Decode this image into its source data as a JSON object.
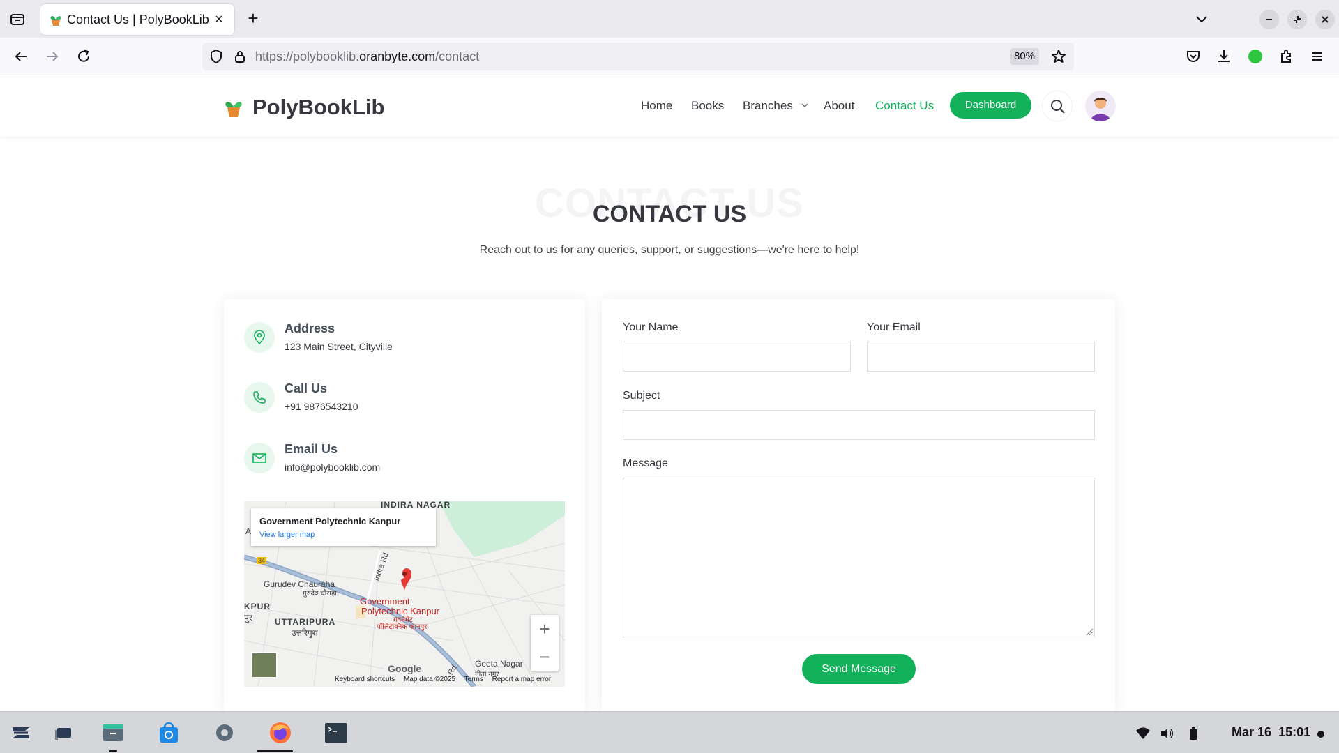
{
  "browser": {
    "tab_title": "Contact Us | PolyBookLib",
    "url_prefix": "https://polybooklib.",
    "url_domain": "oranbyte.com",
    "url_path": "/contact",
    "zoom": "80%"
  },
  "site": {
    "brand": "PolyBookLib",
    "nav": {
      "home": "Home",
      "books": "Books",
      "branches": "Branches",
      "about": "About",
      "contact": "Contact Us",
      "dashboard": "Dashboard"
    },
    "accent_color": "#13b15a"
  },
  "section": {
    "title_bg": "CONTACT US",
    "title": "CONTACT US",
    "subtitle": "Reach out to us for any queries, support, or suggestions—we're here to help!"
  },
  "contact_info": {
    "address_title": "Address",
    "address_value": "123 Main Street, Cityville",
    "phone_title": "Call Us",
    "phone_value": "+91 9876543210",
    "email_title": "Email Us",
    "email_value": "info@polybooklib.com"
  },
  "map": {
    "place_title": "Government Polytechnic Kanpur",
    "larger_map_link": "View larger map",
    "labels": {
      "indira_nagar": "INDIRA NAGAR",
      "gurudev": "Gurudev Chauraha",
      "gurudev_hi": "गुरुदेव चौराहा",
      "indra_rd": "Indra Rd",
      "kpur": "KPUR",
      "kpur_hi": "पुर",
      "uttaripura": "UTTARIPURA",
      "uttaripura_hi": "उत्तरिपुरा",
      "gov_poly_1": "Government",
      "gov_poly_2": "Polytechnic Kanpur",
      "gov_poly_hi1": "गवर्नमेंट",
      "gov_poly_hi2": "पॉलिटेक्निक कानपुर",
      "geeta_nagar": "Geeta Nagar",
      "geeta_nagar_hi": "गीता नगर",
      "road_34": "34",
      "rd": "Rd",
      "a": "A"
    },
    "zoom_in": "+",
    "zoom_out": "−",
    "google": "Google",
    "footer": {
      "shortcuts": "Keyboard shortcuts",
      "map_data": "Map data ©2025",
      "terms": "Terms",
      "report": "Report a map error"
    }
  },
  "form": {
    "name_label": "Your Name",
    "email_label": "Your Email",
    "subject_label": "Subject",
    "message_label": "Message",
    "name_value": "",
    "email_value": "",
    "subject_value": "",
    "message_value": "",
    "send_label": "Send Message"
  },
  "taskbar": {
    "date": "Mar 16",
    "time": "15:01"
  }
}
